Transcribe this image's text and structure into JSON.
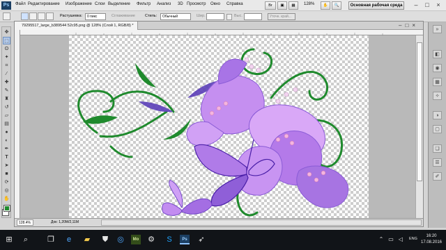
{
  "app": {
    "logo": "Ps"
  },
  "menu": [
    "Файл",
    "Редактирование",
    "Изображение",
    "Слои",
    "Выделение",
    "Фильтр",
    "Анализ",
    "3D",
    "Просмотр",
    "Окно",
    "Справка"
  ],
  "menu_right": {
    "zoom": "128%",
    "workspace": "Основная рабочая среда"
  },
  "options": {
    "feather_label": "Растушевка:",
    "feather_value": "0 пикс",
    "antialias_label": "Сглаживание",
    "style_label": "Стиль:",
    "style_value": "Обычный",
    "width_placeholder": "Шир.",
    "height_placeholder": "Выс.",
    "refine_label": "Уточн. край..."
  },
  "document": {
    "tab_title": "79295517_large_b389544 52c95.png @ 128% (Слой 1, RGB/8) *",
    "zoom": "128.4%",
    "info": "Док: 1,20M/2,11M"
  },
  "toolbox": {
    "foreground_color": "#1f8a2d",
    "background_color": "#ffffff",
    "icons": [
      "move-icon",
      "marquee-icon",
      "lasso-icon",
      "magic-wand-icon",
      "crop-icon",
      "eyedropper-icon",
      "healing-icon",
      "brush-icon",
      "clone-stamp-icon",
      "history-brush-icon",
      "eraser-icon",
      "gradient-icon",
      "blur-icon",
      "dodge-icon",
      "pen-icon",
      "type-icon",
      "path-select-icon",
      "shape-icon",
      "3d-rotate-icon",
      "3d-camera-icon",
      "hand-icon",
      "zoom-icon"
    ]
  },
  "taskbar": {
    "language": "ENG",
    "time": "16:20",
    "date": "17.08.2016"
  }
}
